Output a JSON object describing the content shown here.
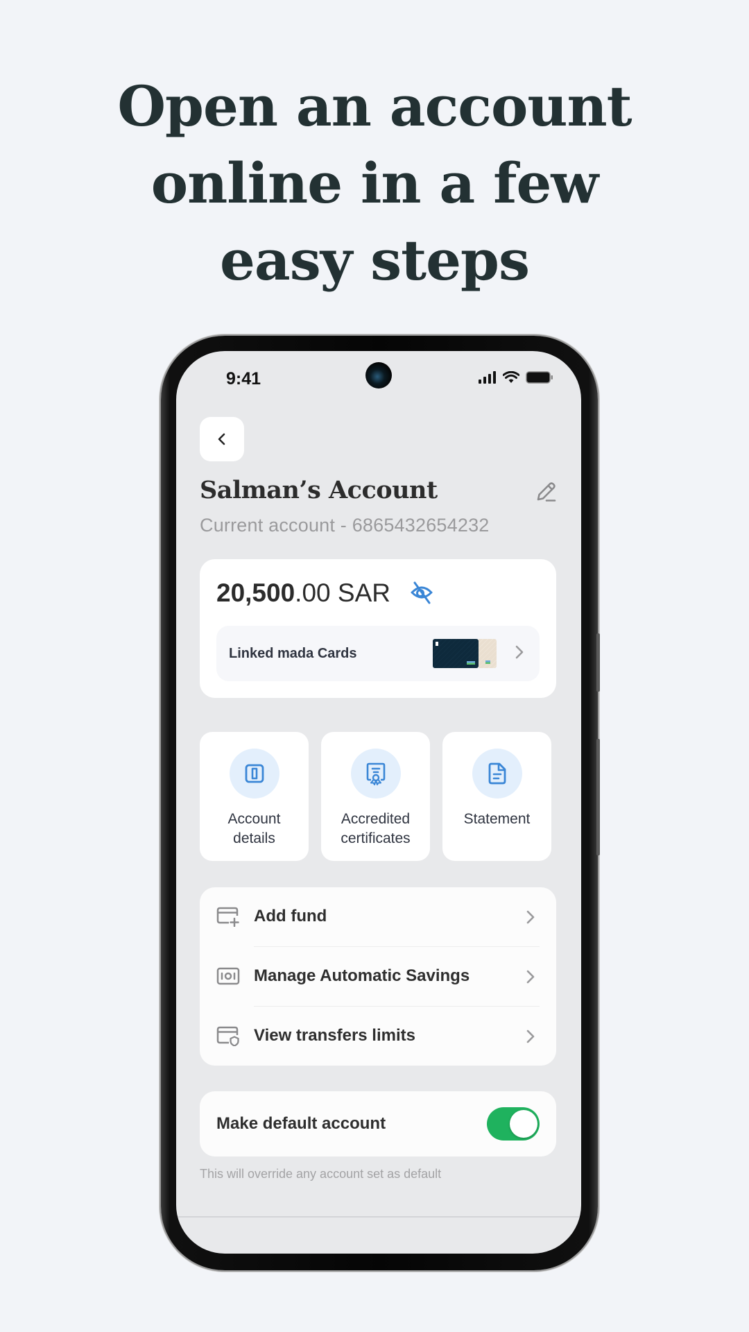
{
  "headline": {
    "lines": [
      "Open an account",
      "online in a few",
      "easy steps"
    ]
  },
  "status_bar": {
    "time": "9:41",
    "icons": [
      "signal-icon",
      "wifi-icon",
      "battery-icon"
    ]
  },
  "header": {
    "back_icon": "chevron-left-icon",
    "title": "Salman’s Account",
    "edit_icon": "pencil-icon",
    "subtitle": "Current account - 6865432654232"
  },
  "balance": {
    "whole": "20,500",
    "decimal": ".00",
    "currency": "SAR",
    "visibility_icon": "eye-off-icon",
    "linked_cards_label": "Linked mada Cards"
  },
  "tiles": [
    {
      "label": "Account details",
      "icon": "account-details-icon"
    },
    {
      "label": "Accredited certificates",
      "icon": "certificate-icon"
    },
    {
      "label": "Statement",
      "icon": "document-icon"
    }
  ],
  "menu": [
    {
      "label": "Add fund",
      "icon": "card-add-icon"
    },
    {
      "label": "Manage Automatic Savings",
      "icon": "savings-icon"
    },
    {
      "label": "View transfers limits",
      "icon": "card-shield-icon"
    }
  ],
  "default_account": {
    "label": "Make default account",
    "enabled": true,
    "note": "This will override any account set as default"
  },
  "colors": {
    "accent_blue": "#3a86d6",
    "toggle_green": "#1fb25e",
    "headline": "#233133"
  }
}
